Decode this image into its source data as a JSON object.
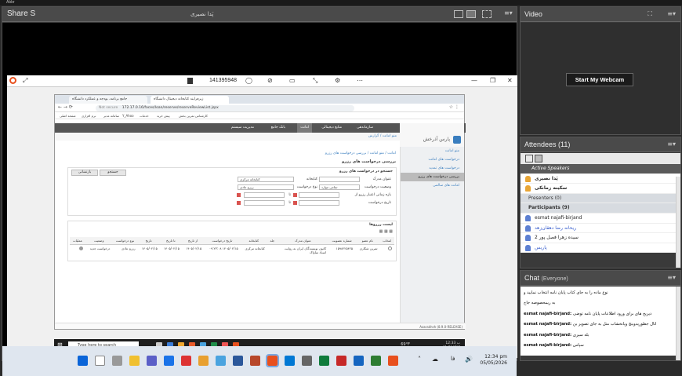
{
  "app": {
    "top_label": "Abbr"
  },
  "share": {
    "title": "Share S",
    "owner": "پَدا نصیری",
    "meeting_number": "141395948"
  },
  "browser": {
    "tabs": [
      "جامع برنامه، بودجه و عملکرد دانشگاه",
      "زیرفرایند کتابخانه دیجیتال دانشگاه"
    ],
    "url_prefix": "Not secure",
    "url": "172.17.0.16/faces/loan/reserve/reserveReviewList.jspx",
    "bookmarks": [
      "صفحه اصلی",
      "نرم افزاری",
      "سامانه مدیر",
      "Y_Ahoo",
      "خدمات",
      "پیش خرید",
      "کارشناس تمرین بخش"
    ],
    "nav": [
      "کتابخانه الکترونیک و دیجیتال",
      "سازماندهی",
      "منابع دیجیتالی",
      "امانت",
      "بانک جامع",
      "مدیریت سیستم"
    ],
    "crumb": "منو امانت / گزارش",
    "logo_text": "پارس آذرخش",
    "sidebar": [
      "منو امانت",
      "درخواست های امانت",
      "درخواست های تمدید",
      "بررسی درخواست های رزرو",
      "امانت های سالمی"
    ],
    "sidebar_selected": 3,
    "path_text": "امانت / منو امانت / بررسی درخواست های رزرو",
    "page_title": "بررسی درخواست های رزرو",
    "search_panel_title": "جستجو در درخواست های رزرو",
    "buttons": {
      "search": "جستجو",
      "reset": "بازنشانی"
    },
    "form": {
      "resource_title": "عنوان مدرک",
      "library": "کتابخانه",
      "library_value": "کتابخانه مرکزی",
      "reserve_status": "وضعیت درخواست",
      "reserve_status_value": "تمامی موارد",
      "request_type": "نوع درخواست",
      "request_type_value": "رزرو عادی",
      "date_from": "بازه زمانی اعتبار رزرو از",
      "request_date": "تاریخ درخواست",
      "to": "تا"
    },
    "results_title": "لیست رزروها",
    "table": {
      "headers": [
        "انتخاب",
        "نام عضو",
        "شماره عضویت",
        "عنوان مدرک",
        "جلد",
        "کتابخانه",
        "تاریخ درخواست",
        "از تاریخ",
        "تا تاریخ",
        "تاریخ",
        "نوع درخواست",
        "وضعیت",
        "عملیات"
      ],
      "rows": [
        [
          "",
          "تمرین شکاری",
          "۱۵۹۸۲۲۵۴۲۵",
          "کانون نویسندگان ایران به روایت اسناد ساواک",
          "",
          "کتابخانه مرکزی",
          "۱۴۰۵/۰۲/۱۵ ۰۹:۲۳:۰۸",
          "۱۴۰۵/۰۲/۱۵",
          "۱۴۰۵/۰۲/۱۵",
          "۱۴۰۵/۰۲/۱۵",
          "رزرو عادی",
          "درخواست جدید",
          ""
        ]
      ]
    },
    "status_bar": "Azarakhsh (8.9.0-RELEASE)"
  },
  "guest_taskbar": {
    "search_placeholder": "Type here to search",
    "temp": "69°F",
    "time": "12:33 ب",
    "date": "۱۴۰۵/۰۲/۱۵"
  },
  "host_taskbar": {
    "lang": "فا",
    "time": "12:34 pm",
    "date": "05/05/2026"
  },
  "video": {
    "title": "Video",
    "webcam_button": "Start My Webcam"
  },
  "attendees": {
    "title": "Attendees",
    "count": "(11)",
    "active_speakers_label": "Active Speakers",
    "speakers": [
      "پَدا نصیری",
      "سکینه زمانکی"
    ],
    "presenters_label": "Presenters (0)",
    "participants_label": "Participants (9)",
    "participants": [
      "esmat najafi-birjand",
      "ریحانه رضا دهقان‌زهد",
      "سیده زهرا فصل پور 2",
      "پاریس"
    ]
  },
  "chat": {
    "title": "Chat",
    "scope": "(Everyone)",
    "messages": [
      {
        "user": "",
        "text": "نوع ماده را به جای کتاب پایان نامه انتخاب نمایید و"
      },
      {
        "user": "",
        "text": "به ریمحصوصه جاج"
      },
      {
        "user": "esmat najafi-birjand:",
        "text": "ذیریخ های برای ورود اطلاعات پایان نامه توضی"
      },
      {
        "user": "esmat najafi-birjand:",
        "text": "اثال جطوريدوينچ وپانخشاب متل به جای تصویر بن"
      },
      {
        "user": "esmat najafi-birjand:",
        "text": "بله سپری"
      },
      {
        "user": "esmat najafi-birjand:",
        "text": "سپاس"
      }
    ]
  },
  "colors": {
    "pod_bg": "#3a3a3a",
    "accent_red": "#d9534f",
    "link_blue": "#3a7ebf"
  }
}
